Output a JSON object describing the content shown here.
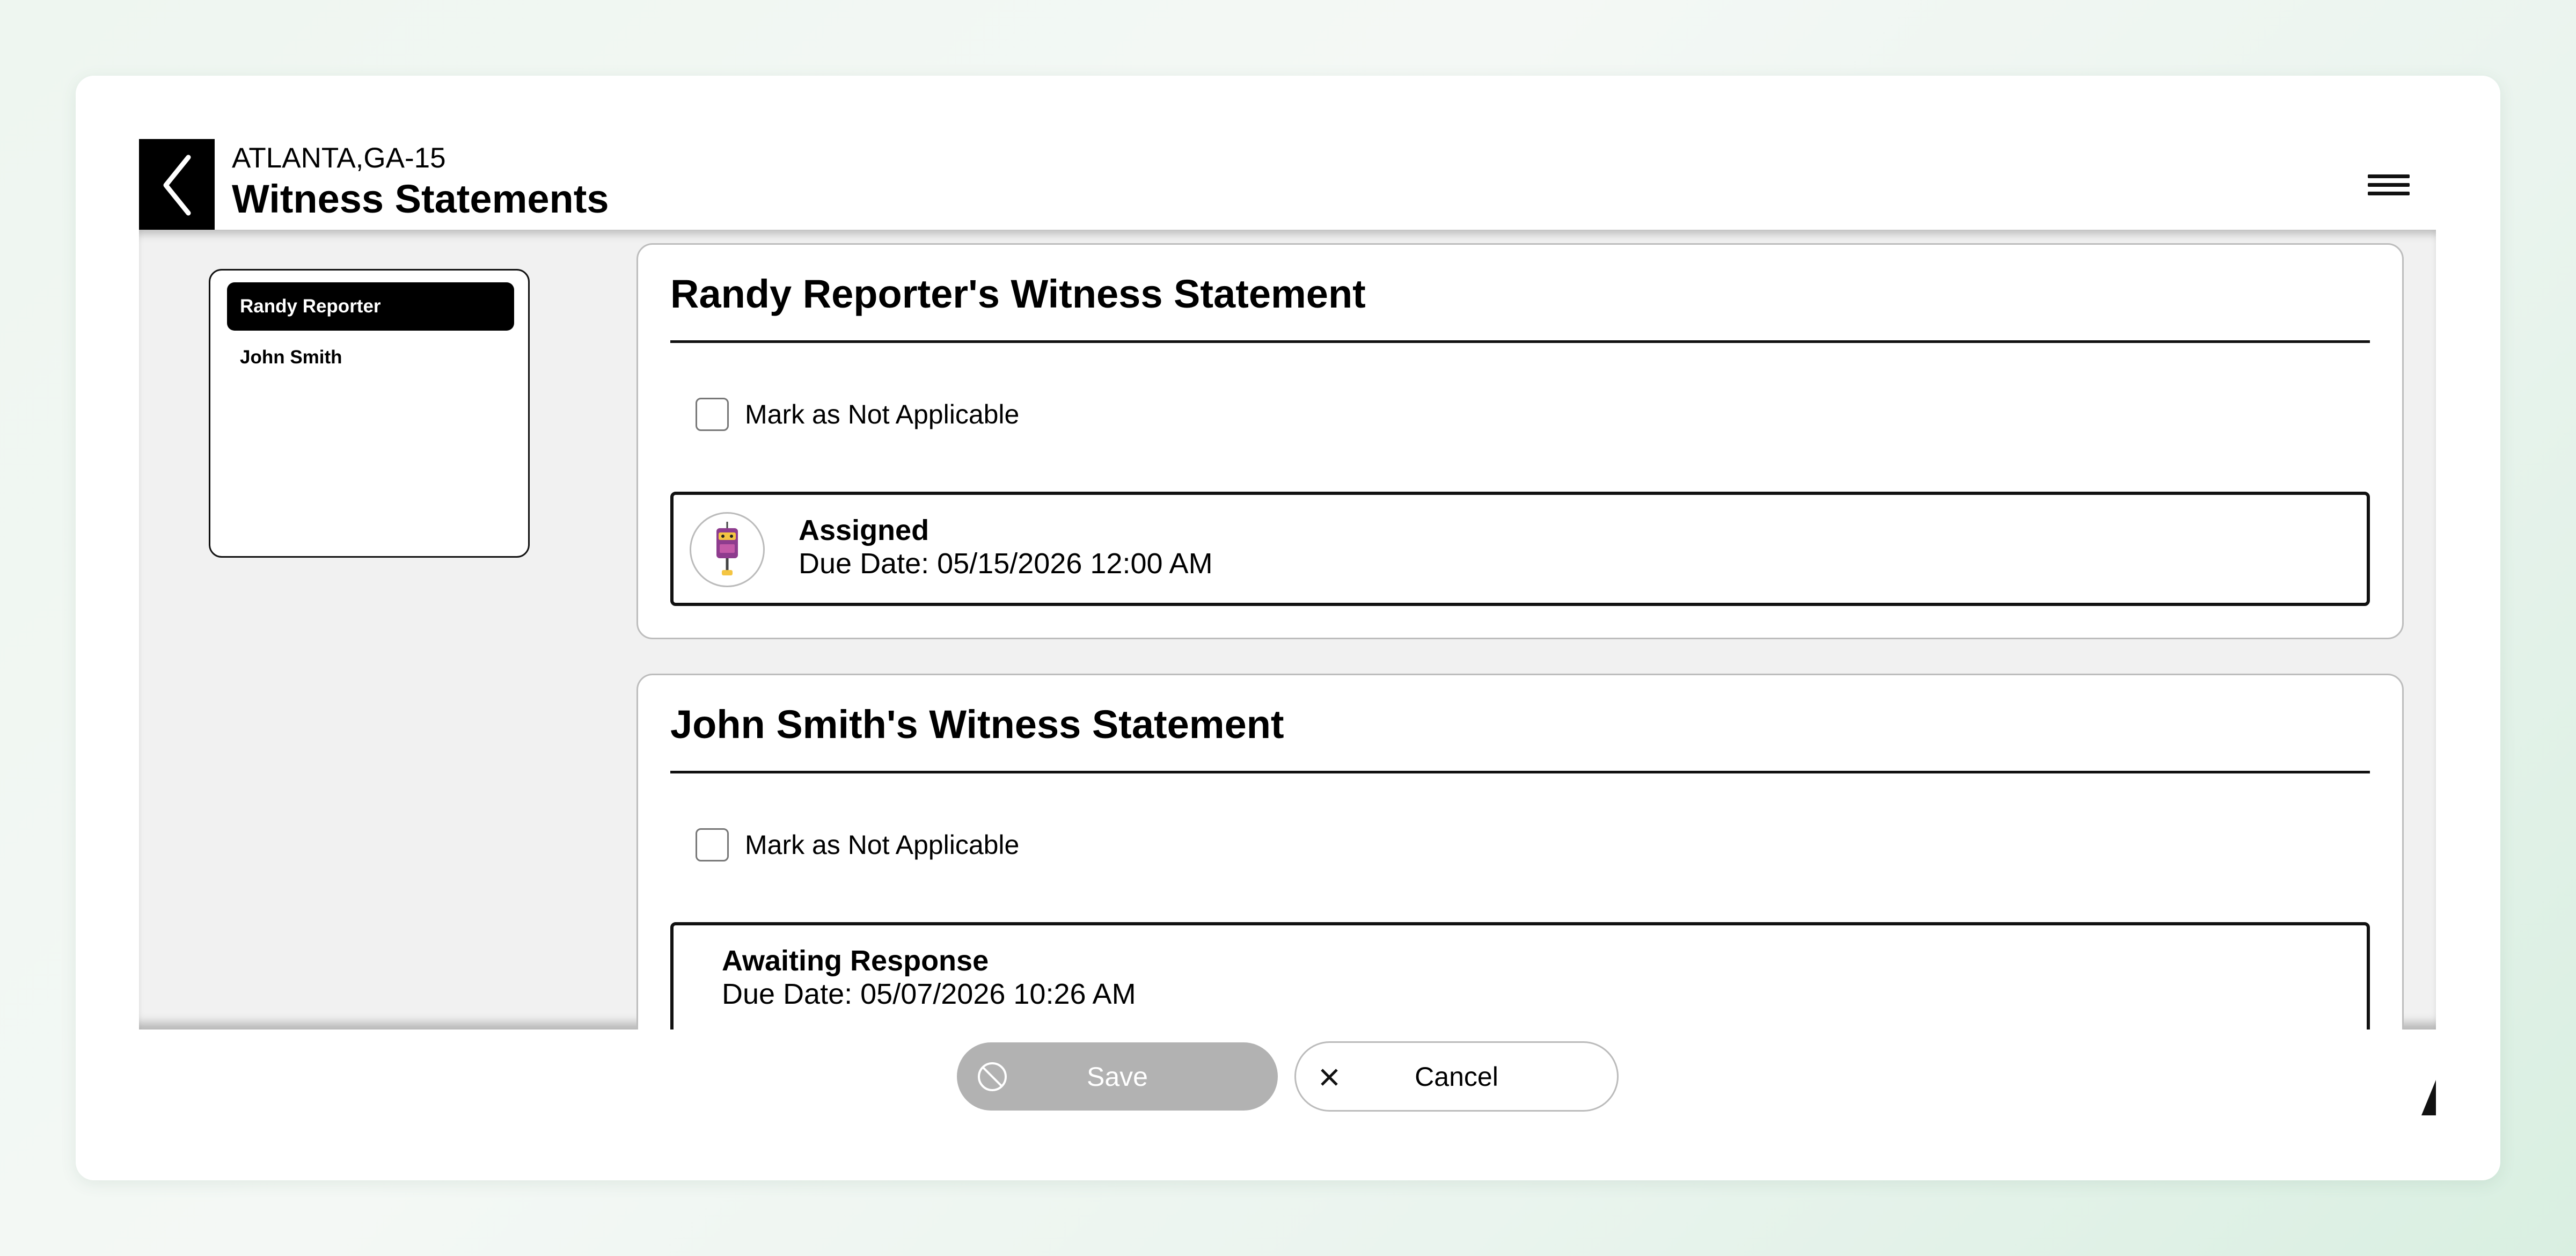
{
  "header": {
    "location": "ATLANTA,GA-15",
    "title": "Witness Statements"
  },
  "witness_list": {
    "items": [
      {
        "name": "Randy Reporter",
        "selected": true
      },
      {
        "name": "John Smith",
        "selected": false
      }
    ]
  },
  "statements": [
    {
      "title": "Randy Reporter's Witness Statement",
      "not_applicable_label": "Mark as Not Applicable",
      "not_applicable_checked": false,
      "status": "Assigned",
      "due_date": "Due Date: 05/15/2026 12:00 AM",
      "has_avatar": true
    },
    {
      "title": "John Smith's Witness Statement",
      "not_applicable_label": "Mark as Not Applicable",
      "not_applicable_checked": false,
      "status": "Awaiting Response",
      "due_date": "Due Date: 05/07/2026 10:26 AM",
      "has_avatar": false
    }
  ],
  "footer": {
    "save_label": "Save",
    "cancel_label": "Cancel",
    "save_disabled": true
  },
  "icons": {
    "back": "chevron-left-icon",
    "menu": "hamburger-menu-icon",
    "save": "disabled-icon",
    "cancel": "close-icon",
    "avatar": "robot-avatar-icon"
  },
  "colors": {
    "primary": "#000000",
    "selected_item_bg": "#000000",
    "disabled_button": "#b2b2b2",
    "content_bg": "#f1f1f1"
  }
}
